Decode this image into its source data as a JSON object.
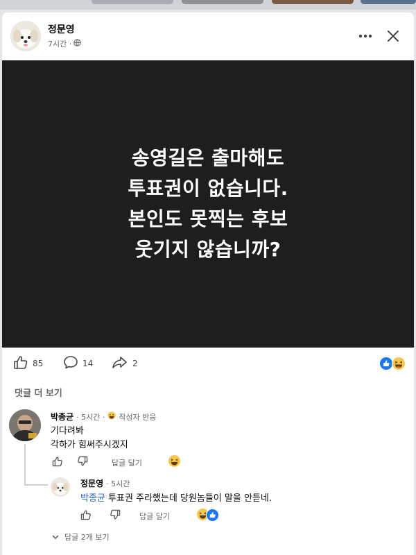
{
  "post": {
    "author": "정문영",
    "time": "7시간 ·",
    "image_text": [
      "송영길은 출마해도",
      "투표권이 없습니다.",
      "본인도 못찍는 후보",
      "웃기지 않습니까?"
    ],
    "like_count": "85",
    "comment_count": "14",
    "share_count": "2"
  },
  "icons": {
    "privacy": "globe-icon",
    "more": "more-horizontal-icon",
    "close": "close-icon",
    "like": "thumbs-up-icon",
    "comment": "comment-bubble-icon",
    "share": "share-arrow-icon"
  },
  "comments": {
    "more_label": "댓글 더 보기",
    "first": {
      "author": "박종균",
      "time": "· 5시간 ·",
      "badge": "작성자 반응",
      "lines": [
        "기다려봐",
        "각하가 힘써주시겠지"
      ],
      "reply_label": "답글 달기"
    },
    "reply": {
      "author": "정문영",
      "time": "· 5시간",
      "mention": "박종균",
      "text": " 투표권 주라했는데 당원놈들이 말을 안듣네.",
      "reply_label": "답글 달기"
    },
    "view_replies": "답글 2개 보기"
  },
  "colors": {
    "brand_blue": "#1877f2",
    "mention_blue": "#1f5fd6",
    "image_bg": "#1e1e1e",
    "emoji_yellow": "#f7c84a"
  }
}
